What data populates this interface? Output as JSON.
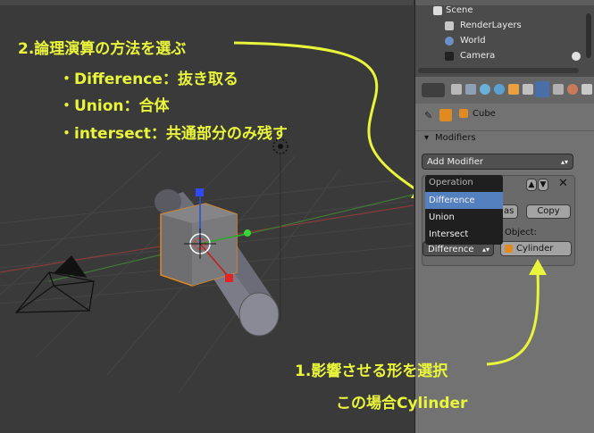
{
  "annotations": {
    "step2_title": "2.論理演算の方法を選ぶ",
    "step2_items": [
      "・Difference：抜き取る",
      "・Union：合体",
      "・intersect：共通部分のみ残す"
    ],
    "step1_title": "1.影響させる形を選択",
    "step1_sub": "この場合Cylinder",
    "color": "#e9f53a"
  },
  "outliner": {
    "rows": [
      {
        "label": "Scene",
        "icon": "scene-icon"
      },
      {
        "label": "RenderLayers",
        "icon": "render-layers-icon"
      },
      {
        "label": "World",
        "icon": "world-icon"
      },
      {
        "label": "Camera",
        "icon": "camera-icon"
      }
    ]
  },
  "properties": {
    "object_name": "Cube",
    "modifiers_header": "Modifiers",
    "add_modifier": "Add Modifier",
    "apply_label": "Apply as S",
    "copy_label": "Copy",
    "operation_label": "Operation",
    "operation_options": [
      "Difference",
      "Union",
      "Intersect"
    ],
    "operation_selected": "Difference",
    "object_label": "Object:",
    "object_value": "Cylinder"
  }
}
